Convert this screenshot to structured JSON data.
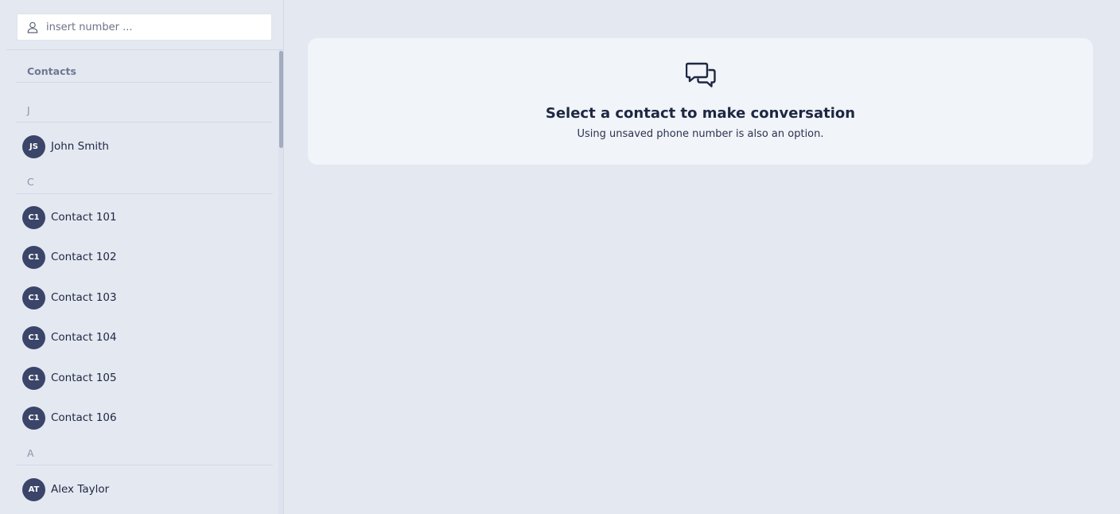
{
  "search": {
    "placeholder": "insert number ...",
    "icon": "user-icon"
  },
  "sidebar": {
    "heading": "Contacts",
    "groups": [
      {
        "letter": "J",
        "contacts": [
          {
            "initials": "JS",
            "name": "John Smith"
          }
        ]
      },
      {
        "letter": "C",
        "contacts": [
          {
            "initials": "C1",
            "name": "Contact 101"
          },
          {
            "initials": "C1",
            "name": "Contact 102"
          },
          {
            "initials": "C1",
            "name": "Contact 103"
          },
          {
            "initials": "C1",
            "name": "Contact 104"
          },
          {
            "initials": "C1",
            "name": "Contact 105"
          },
          {
            "initials": "C1",
            "name": "Contact 106"
          }
        ]
      },
      {
        "letter": "A",
        "contacts": [
          {
            "initials": "AT",
            "name": "Alex Taylor"
          }
        ]
      }
    ]
  },
  "empty_state": {
    "icon": "chat-bubbles-icon",
    "title": "Select a contact to make conversation",
    "subtitle": "Using unsaved phone number is also an option."
  },
  "colors": {
    "background": "#e4e8f1",
    "card": "#f1f4f8",
    "avatar": "#3b4569",
    "text": "#1e2742"
  }
}
